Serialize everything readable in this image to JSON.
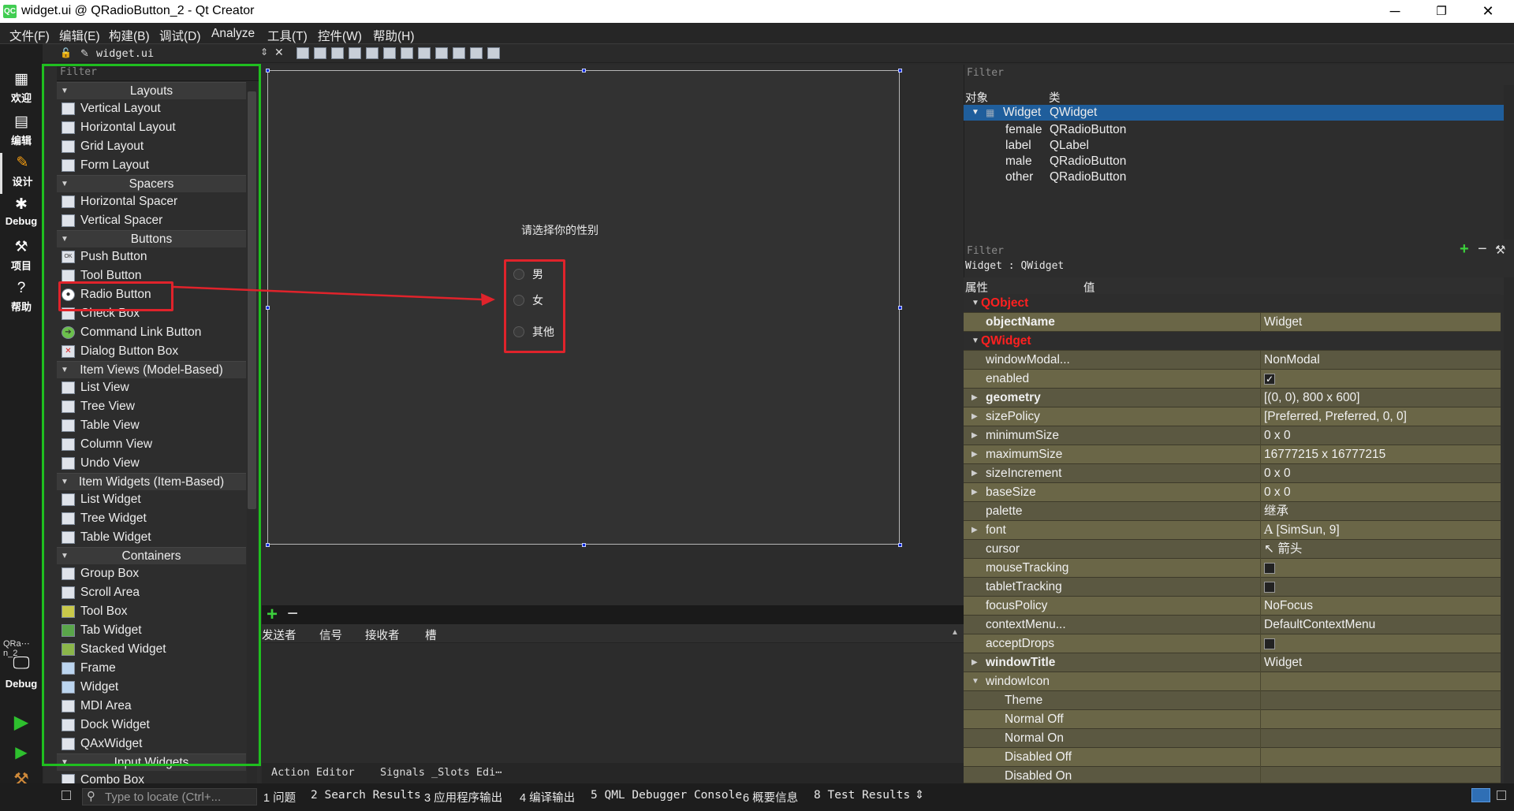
{
  "window": {
    "title": "widget.ui @ QRadioButton_2 - Qt Creator",
    "app_icon": "QC",
    "minimize": "─",
    "maximize": "❐",
    "close": "✕"
  },
  "menubar": [
    "文件(F)",
    "编辑(E)",
    "构建(B)",
    "调试(D)",
    "Analyze",
    "工具(T)",
    "控件(W)",
    "帮助(H)"
  ],
  "modes": [
    {
      "label": "欢迎",
      "icon": "grid-icon"
    },
    {
      "label": "编辑",
      "icon": "document-icon"
    },
    {
      "label": "设计",
      "icon": "pencil-icon"
    },
    {
      "label": "Debug",
      "icon": "bug-icon"
    },
    {
      "label": "项目",
      "icon": "wrench-icon"
    },
    {
      "label": "帮助",
      "icon": "help-icon"
    }
  ],
  "kit": {
    "project": "QRa⋯n_2",
    "label": "Debug"
  },
  "doc_toolbar": {
    "file": "widget.ui",
    "close": "✕"
  },
  "widgetbox": {
    "filter_placeholder": "Filter",
    "categories": {
      "layouts": "Layouts",
      "spacers": "Spacers",
      "buttons": "Buttons",
      "item_views": "Item Views (Model-Based)",
      "item_widgets": "Item Widgets (Item-Based)",
      "containers": "Containers",
      "input_widgets": "Input Widgets"
    },
    "items": {
      "vertical_layout": "Vertical Layout",
      "horizontal_layout": "Horizontal Layout",
      "grid_layout": "Grid Layout",
      "form_layout": "Form Layout",
      "horizontal_spacer": "Horizontal Spacer",
      "vertical_spacer": "Vertical Spacer",
      "push_button": "Push Button",
      "tool_button": "Tool Button",
      "radio_button": "Radio Button",
      "check_box": "Check Box",
      "command_link_button": "Command Link Button",
      "dialog_button_box": "Dialog Button Box",
      "list_view": "List View",
      "tree_view": "Tree View",
      "table_view": "Table View",
      "column_view": "Column View",
      "undo_view": "Undo View",
      "list_widget": "List Widget",
      "tree_widget": "Tree Widget",
      "table_widget": "Table Widget",
      "group_box": "Group Box",
      "scroll_area": "Scroll Area",
      "tool_box": "Tool Box",
      "tab_widget": "Tab Widget",
      "stacked_widget": "Stacked Widget",
      "frame": "Frame",
      "widget": "Widget",
      "mdi_area": "MDI Area",
      "dock_widget": "Dock Widget",
      "qaxwidget": "QAxWidget",
      "combo_box": "Combo Box"
    },
    "icon_text": {
      "push": "OK",
      "dialog": "✕"
    }
  },
  "form": {
    "label_text": "请选择你的性别",
    "radios": [
      "男",
      "女",
      "其他"
    ]
  },
  "signals_slots": {
    "add": "+",
    "remove": "−",
    "columns": [
      "发送者",
      "信号",
      "接收者",
      "槽"
    ]
  },
  "bottom_tabs": [
    "Action Editor",
    "Signals _Slots Edi⋯"
  ],
  "object_inspector": {
    "filter_placeholder": "Filter",
    "headers": [
      "对象",
      "类"
    ],
    "rows": [
      {
        "name": "Widget",
        "class": "QWidget"
      },
      {
        "name": "female",
        "class": "QRadioButton"
      },
      {
        "name": "label",
        "class": "QLabel"
      },
      {
        "name": "male",
        "class": "QRadioButton"
      },
      {
        "name": "other",
        "class": "QRadioButton"
      }
    ]
  },
  "property_editor": {
    "filter_placeholder": "Filter",
    "class_line": "Widget : QWidget",
    "headers": [
      "属性",
      "值"
    ],
    "groups": {
      "qobject": "QObject",
      "qwidget": "QWidget"
    },
    "props": {
      "objectName": {
        "name": "objectName",
        "value": "Widget"
      },
      "windowModality": {
        "name": "windowModal...",
        "value": "NonModal"
      },
      "enabled": {
        "name": "enabled",
        "value": "✓"
      },
      "geometry": {
        "name": "geometry",
        "value": "[(0, 0), 800 x 600]"
      },
      "sizePolicy": {
        "name": "sizePolicy",
        "value": "[Preferred, Preferred, 0, 0]"
      },
      "minimumSize": {
        "name": "minimumSize",
        "value": "0 x 0"
      },
      "maximumSize": {
        "name": "maximumSize",
        "value": "16777215 x 16777215"
      },
      "sizeIncrement": {
        "name": "sizeIncrement",
        "value": "0 x 0"
      },
      "baseSize": {
        "name": "baseSize",
        "value": "0 x 0"
      },
      "palette": {
        "name": "palette",
        "value": "继承"
      },
      "font": {
        "name": "font",
        "value": "[SimSun, 9]",
        "glyph": "A"
      },
      "cursor": {
        "name": "cursor",
        "value": "箭头",
        "glyph": "↖"
      },
      "mouseTracking": {
        "name": "mouseTracking",
        "value": ""
      },
      "tabletTracking": {
        "name": "tabletTracking",
        "value": ""
      },
      "focusPolicy": {
        "name": "focusPolicy",
        "value": "NoFocus"
      },
      "contextMenuPolicy": {
        "name": "contextMenu...",
        "value": "DefaultContextMenu"
      },
      "acceptDrops": {
        "name": "acceptDrops",
        "value": ""
      },
      "windowTitle": {
        "name": "windowTitle",
        "value": "Widget"
      },
      "windowIcon": {
        "name": "windowIcon",
        "value": ""
      },
      "theme": {
        "name": "Theme",
        "value": ""
      },
      "normalOff": {
        "name": "Normal Off",
        "value": ""
      },
      "normalOn": {
        "name": "Normal On",
        "value": ""
      },
      "disabledOff": {
        "name": "Disabled Off",
        "value": ""
      },
      "disabledOn": {
        "name": "Disabled On",
        "value": ""
      }
    }
  },
  "statusbar": {
    "locator_placeholder": "Type to locate (Ctrl+...",
    "tabs": [
      "1 问题",
      "2 Search Results",
      "3 应用程序输出",
      "4 编译输出",
      "5 QML Debugger Console",
      "6 概要信息",
      "8 Test Results"
    ],
    "more": "⇕"
  },
  "colors": {
    "annotation_red": "#e0232b",
    "highlight_green": "#1fbf1f",
    "selection": "#1f5e9c"
  }
}
